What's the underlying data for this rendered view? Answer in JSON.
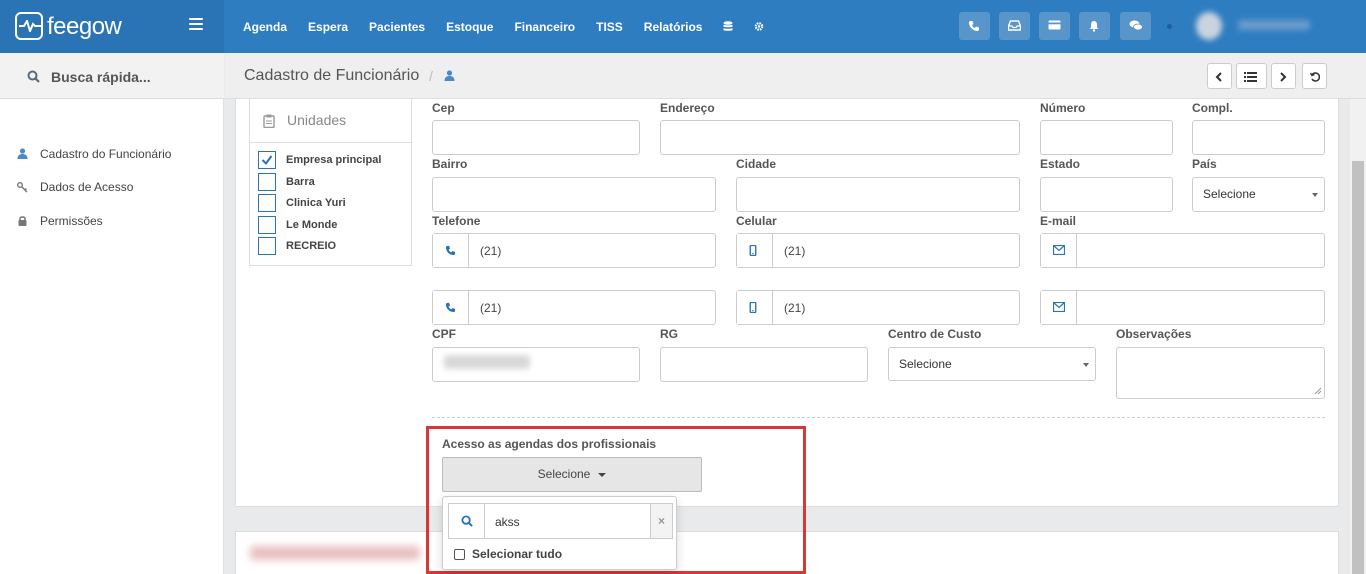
{
  "brand": {
    "name": "feegow"
  },
  "nav": {
    "items": [
      "Agenda",
      "Espera",
      "Pacientes",
      "Estoque",
      "Financeiro",
      "TISS",
      "Relatórios"
    ]
  },
  "sidebar": {
    "search_label": "Busca rápida...",
    "items": [
      {
        "label": "Cadastro do Funcionário",
        "icon": "user-icon"
      },
      {
        "label": "Dados de Acesso",
        "icon": "key-icon"
      },
      {
        "label": "Permissões",
        "icon": "lock-icon"
      }
    ]
  },
  "header": {
    "title": "Cadastro de Funcionário",
    "separator": "/"
  },
  "units": {
    "title": "Unidades",
    "items": [
      {
        "label": "Empresa principal",
        "checked": true
      },
      {
        "label": "Barra",
        "checked": false
      },
      {
        "label": "Clinica Yuri",
        "checked": false
      },
      {
        "label": "Le Monde",
        "checked": false
      },
      {
        "label": "RECREIO",
        "checked": false
      }
    ]
  },
  "form": {
    "cep": "Cep",
    "endereco": "Endereço",
    "numero": "Número",
    "compl": "Compl.",
    "bairro": "Bairro",
    "cidade": "Cidade",
    "estado": "Estado",
    "pais": "País",
    "pais_value": "Selecione",
    "telefone": "Telefone",
    "celular": "Celular",
    "email": "E-mail",
    "tel1": "(21)",
    "cel1": "(21)",
    "tel2": "(21)",
    "cel2": "(21)",
    "cpf": "CPF",
    "rg": "RG",
    "centro_custo": "Centro de Custo",
    "centro_custo_value": "Selecione",
    "observacoes": "Observações"
  },
  "access": {
    "label": "Acesso as agendas dos profissionais",
    "select_label": "Selecione",
    "search_value": "akss",
    "clear": "×",
    "select_all": "Selecionar tudo"
  }
}
